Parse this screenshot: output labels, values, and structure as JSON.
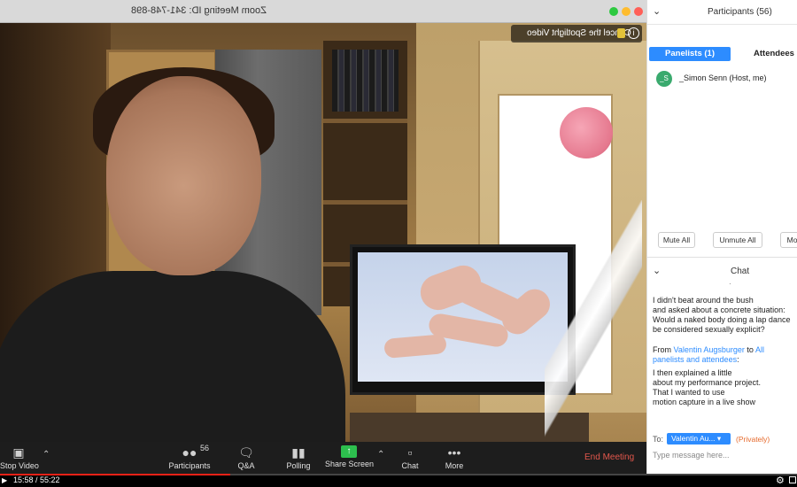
{
  "window": {
    "title": "Zoom Meeting ID: 341-748-898"
  },
  "video": {
    "spotlight_label": "Cancel the Spotlight Video",
    "info_glyph": "i"
  },
  "toolbar": {
    "stop_video": "Stop Video",
    "participants": "Participants",
    "participants_count": "56",
    "qa": "Q&A",
    "polling": "Polling",
    "share_screen": "Share Screen",
    "chat": "Chat",
    "more": "More",
    "end_meeting": "End Meeting"
  },
  "participants_panel": {
    "title": "Participants (56)",
    "tab_panelists": "Panelists (1)",
    "tab_attendees": "Attendees",
    "panelists": [
      {
        "initials": "_S",
        "name": "_Simon Senn (Host, me)"
      }
    ],
    "buttons": {
      "mute_all": "Mute All",
      "unmute_all": "Unmute All",
      "more": "Mor"
    }
  },
  "chat_panel": {
    "title": "Chat",
    "dot": "·",
    "message_1": [
      "I didn't beat around the bush",
      "and asked about a concrete situation:",
      "Would a naked body doing a lap dance",
      "be considered sexually explicit?"
    ],
    "from_prefix": "From",
    "from_name": "Valentin Augsburger",
    "to_word": "to",
    "to_name_1": "All",
    "to_name_2": "panelists and attendees",
    "message_2": [
      "I then explained a little",
      "about my performance project.",
      "That I wanted to use",
      "motion capture in a live show"
    ],
    "to_label": "To:",
    "to_value": "Valentin Au...",
    "privately": "(Privately)",
    "input_placeholder": "Type message here..."
  },
  "player": {
    "time": "15:58 / 55:22",
    "progress": 0.289,
    "accent": "#e62117"
  }
}
